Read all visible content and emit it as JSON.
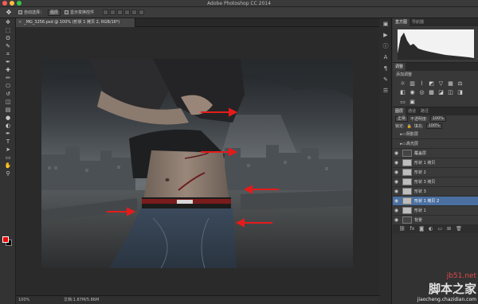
{
  "window": {
    "title": "Adobe Photoshop CC 2014",
    "lights": [
      "#fc5c56",
      "#fdbc40",
      "#33c748"
    ]
  },
  "options": {
    "auto_select_label": "自动选择：",
    "auto_select_target": "图层",
    "show_transform_label": "显示变换控件"
  },
  "document": {
    "tab_label": "_MG_3256.psd @ 100% (形状 1 拷贝 2, RGB/16*)",
    "zoom": "100%",
    "doc_info": "文档:1.87M/5.86M"
  },
  "tools": [
    "move-icon",
    "marquee-icon",
    "lasso-icon",
    "quick-select-icon",
    "crop-icon",
    "eyedropper-icon",
    "healing-icon",
    "brush-icon",
    "stamp-icon",
    "history-brush-icon",
    "eraser-icon",
    "gradient-icon",
    "blur-icon",
    "dodge-icon",
    "pen-icon",
    "type-icon",
    "path-select-icon",
    "shape-icon",
    "hand-icon",
    "zoom-icon"
  ],
  "tool_glyphs": [
    "✥",
    "⬚",
    "ʘ",
    "✎",
    "⌗",
    "✒",
    "✚",
    "✏",
    "⎔",
    "↺",
    "◫",
    "▤",
    "●",
    "◐",
    "✒",
    "T",
    "➤",
    "▭",
    "✋",
    "⚲"
  ],
  "panels": {
    "histogram_tabs": [
      "直方图",
      "导航器"
    ],
    "adjust_tabs": [
      "调整"
    ],
    "adjust_title": "添加调整",
    "layers_tabs": [
      "图层",
      "通道",
      "路径"
    ],
    "kind_label": "正常",
    "opacity_label": "不透明度:",
    "opacity_value": "100%",
    "lock_label": "锁定:",
    "fill_label": "填充:",
    "fill_value": "100%"
  },
  "layers": [
    {
      "name": "阴影层",
      "visible": false,
      "type": "group",
      "thumb": "none",
      "selected": false
    },
    {
      "name": "高光层",
      "visible": false,
      "type": "group",
      "thumb": "none",
      "selected": false
    },
    {
      "name": "覆盖层",
      "visible": true,
      "type": "layer",
      "thumb": "dark",
      "selected": false
    },
    {
      "name": "形状 1 拷贝",
      "visible": true,
      "type": "layer",
      "thumb": "light",
      "selected": false
    },
    {
      "name": "形状 2",
      "visible": true,
      "type": "layer",
      "thumb": "light",
      "selected": false
    },
    {
      "name": "形状 3 拷贝",
      "visible": true,
      "type": "layer",
      "thumb": "light",
      "selected": false
    },
    {
      "name": "形状 3",
      "visible": true,
      "type": "layer",
      "thumb": "light",
      "selected": false
    },
    {
      "name": "形状 1 拷贝 2",
      "visible": true,
      "type": "layer",
      "thumb": "light",
      "selected": true
    },
    {
      "name": "形状 1",
      "visible": true,
      "type": "layer",
      "thumb": "light",
      "selected": false
    },
    {
      "name": "背景",
      "visible": true,
      "type": "layer",
      "thumb": "dark",
      "selected": false
    }
  ],
  "watermark": {
    "big": "脚本之家",
    "site": "jb51.net",
    "url": "jiaocheng.chazidian.com"
  },
  "colors": {
    "foreground": "#e00000",
    "background": "#000000",
    "arrow": "#e51b1b",
    "selection": "#4a6fa0"
  }
}
